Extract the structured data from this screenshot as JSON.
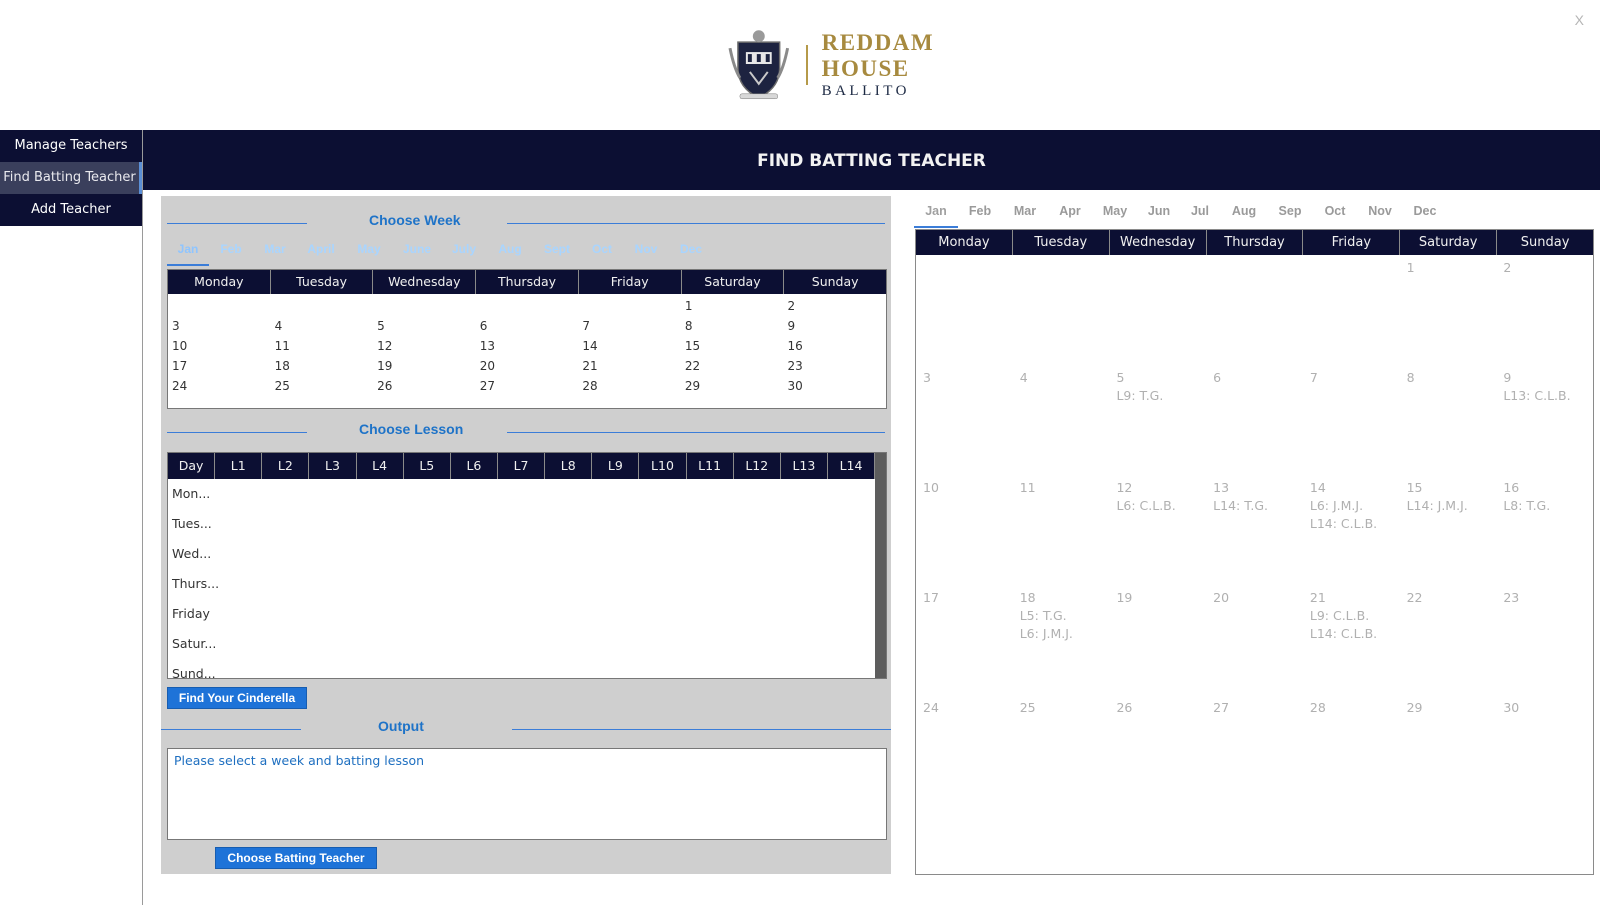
{
  "window": {
    "close_label": "X"
  },
  "brand": {
    "name": "REDDAM HOUSE",
    "location": "BALLITO",
    "gold": "#a78a3f",
    "navy": "#0c0f33"
  },
  "sidebar": {
    "items": [
      {
        "label": "Manage Teachers",
        "active": false
      },
      {
        "label": "Find Batting Teacher",
        "active": true
      },
      {
        "label": "Add Teacher",
        "active": false
      }
    ]
  },
  "page_title": "FIND BATTING TEACHER",
  "choose_week": {
    "heading": "Choose Week",
    "months": [
      "Jan",
      "Feb",
      "Mar",
      "April",
      "May",
      "June",
      "July",
      "Aug",
      "Sept",
      "Oct",
      "Nov",
      "Dec"
    ],
    "active_month": "Jan",
    "weekdays": [
      "Monday",
      "Tuesday",
      "Wednesday",
      "Thursday",
      "Friday",
      "Saturday",
      "Sunday"
    ],
    "weeks": [
      [
        "",
        "",
        "",
        "",
        "",
        "1",
        "2"
      ],
      [
        "3",
        "4",
        "5",
        "6",
        "7",
        "8",
        "9"
      ],
      [
        "10",
        "11",
        "12",
        "13",
        "14",
        "15",
        "16"
      ],
      [
        "17",
        "18",
        "19",
        "20",
        "21",
        "22",
        "23"
      ],
      [
        "24",
        "25",
        "26",
        "27",
        "28",
        "29",
        "30"
      ]
    ]
  },
  "choose_lesson": {
    "heading": "Choose Lesson",
    "columns": [
      "Day",
      "L1",
      "L2",
      "L3",
      "L4",
      "L5",
      "L6",
      "L7",
      "L8",
      "L9",
      "L10",
      "L11",
      "L12",
      "L13",
      "L14"
    ],
    "rows": [
      "Mon...",
      "Tues...",
      "Wed...",
      "Thurs...",
      "Friday",
      "Satur...",
      "Sund..."
    ]
  },
  "find_button": "Find Your Cinderella",
  "output": {
    "heading": "Output",
    "text": "Please select a week and batting lesson"
  },
  "choose_button": "Choose Batting Teacher",
  "right_calendar": {
    "months": [
      "Jan",
      "Feb",
      "Mar",
      "Apr",
      "May",
      "Jun",
      "Jul",
      "Aug",
      "Sep",
      "Oct",
      "Nov",
      "Dec"
    ],
    "active_month": "Jan",
    "weekdays": [
      "Monday",
      "Tuesday",
      "Wednesday",
      "Thursday",
      "Friday",
      "Saturday",
      "Sunday"
    ],
    "weeks": [
      [
        {
          "day": "",
          "events": []
        },
        {
          "day": "",
          "events": []
        },
        {
          "day": "",
          "events": []
        },
        {
          "day": "",
          "events": []
        },
        {
          "day": "",
          "events": []
        },
        {
          "day": "1",
          "events": []
        },
        {
          "day": "2",
          "events": []
        }
      ],
      [
        {
          "day": "3",
          "events": []
        },
        {
          "day": "4",
          "events": []
        },
        {
          "day": "5",
          "events": [
            "L9: T.G."
          ]
        },
        {
          "day": "6",
          "events": []
        },
        {
          "day": "7",
          "events": []
        },
        {
          "day": "8",
          "events": []
        },
        {
          "day": "9",
          "events": [
            "L13: C.L.B."
          ]
        }
      ],
      [
        {
          "day": "10",
          "events": []
        },
        {
          "day": "11",
          "events": []
        },
        {
          "day": "12",
          "events": [
            "L6: C.L.B."
          ]
        },
        {
          "day": "13",
          "events": [
            "L14: T.G."
          ]
        },
        {
          "day": "14",
          "events": [
            "L6: J.M.J.",
            "L14: C.L.B."
          ]
        },
        {
          "day": "15",
          "events": [
            "L14: J.M.J."
          ]
        },
        {
          "day": "16",
          "events": [
            "L8: T.G."
          ]
        }
      ],
      [
        {
          "day": "17",
          "events": []
        },
        {
          "day": "18",
          "events": [
            "L5: T.G.",
            "L6: J.M.J."
          ]
        },
        {
          "day": "19",
          "events": []
        },
        {
          "day": "20",
          "events": []
        },
        {
          "day": "21",
          "events": [
            "L9: C.L.B.",
            "L14: C.L.B."
          ]
        },
        {
          "day": "22",
          "events": []
        },
        {
          "day": "23",
          "events": []
        }
      ],
      [
        {
          "day": "24",
          "events": []
        },
        {
          "day": "25",
          "events": []
        },
        {
          "day": "26",
          "events": []
        },
        {
          "day": "27",
          "events": []
        },
        {
          "day": "28",
          "events": []
        },
        {
          "day": "29",
          "events": []
        },
        {
          "day": "30",
          "events": []
        }
      ]
    ]
  }
}
